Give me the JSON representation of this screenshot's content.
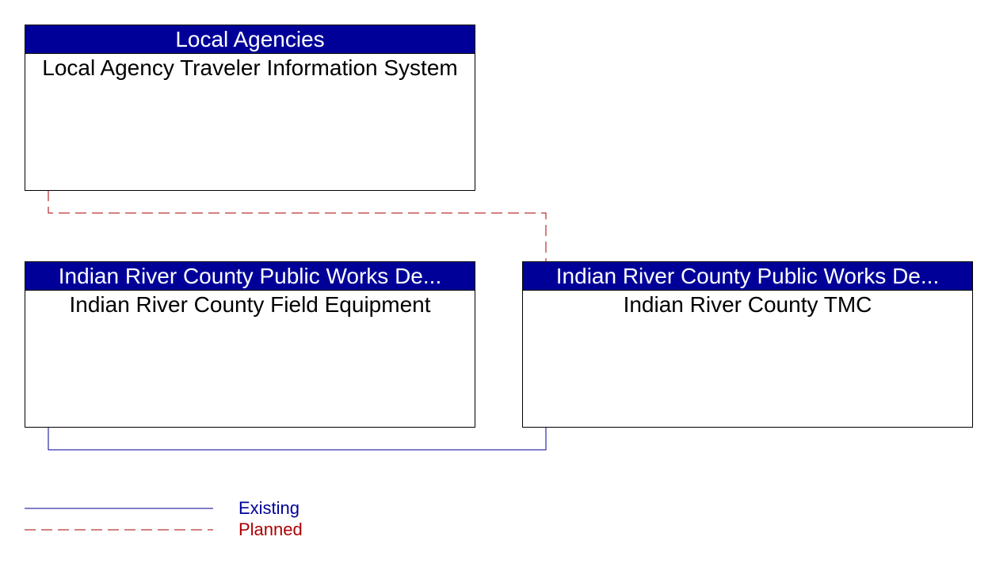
{
  "boxes": {
    "local_agencies": {
      "header": "Local Agencies",
      "title": "Local Agency Traveler Information System"
    },
    "field_equipment": {
      "header": "Indian River County Public Works De...",
      "title": "Indian River County Field Equipment"
    },
    "tmc": {
      "header": "Indian River County Public Works De...",
      "title": "Indian River County TMC"
    }
  },
  "connections": [
    {
      "from": "local_agencies",
      "to": "tmc",
      "status": "Planned"
    },
    {
      "from": "field_equipment",
      "to": "tmc",
      "status": "Existing"
    }
  ],
  "legend": {
    "existing": {
      "label": "Existing",
      "color": "#000099"
    },
    "planned": {
      "label": "Planned",
      "color": "#aa0000"
    }
  }
}
